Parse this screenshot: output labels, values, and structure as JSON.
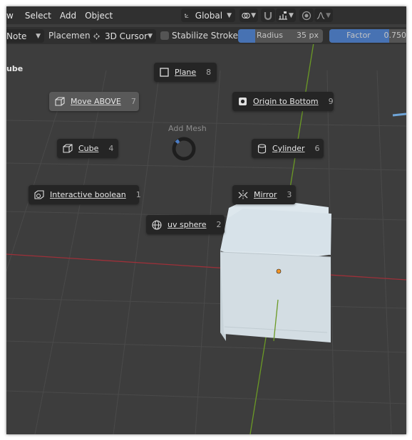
{
  "menubar": {
    "items": [
      "w",
      "Select",
      "Add",
      "Object"
    ],
    "orientation": "Global",
    "snap_icon": "magnet-icon",
    "proportional_icon": "falloff-curve-icon"
  },
  "toolbar": {
    "mode_value": "Note",
    "placement_label": "Placement:",
    "placement_value": "3D Cursor",
    "stabilize_label": "Stabilize Stroke",
    "stabilize_checked": false,
    "radius_label": "Radius",
    "radius_value": "35 px",
    "radius_level": 0.2,
    "factor_label": "Factor",
    "factor_value": "0.750",
    "factor_level": 0.75
  },
  "scene_label": "ube",
  "pie_menu": {
    "title": "Add Mesh",
    "items": [
      {
        "label": "Plane",
        "key": "8",
        "icon": "plane-icon"
      },
      {
        "label": "Move ABOVE",
        "key": "7",
        "icon": "cube-move-icon",
        "active": true
      },
      {
        "label": "Origin to Bottom",
        "key": "9",
        "icon": "origin-icon"
      },
      {
        "label": "Cube",
        "key": "4",
        "icon": "cube-icon"
      },
      {
        "label": "Cylinder",
        "key": "6",
        "icon": "cylinder-icon"
      },
      {
        "label": "Interactive boolean",
        "key": "1",
        "icon": "boolean-icon"
      },
      {
        "label": "Mirror",
        "key": "3",
        "icon": "mirror-icon"
      },
      {
        "label": "uv sphere",
        "key": "2",
        "icon": "sphere-icon"
      }
    ]
  },
  "colors": {
    "viewport_bg": "#3d3d3d",
    "header_bg": "#303030",
    "x_axis": "#a8323c",
    "y_axis": "#6a9a24",
    "slider_fill": "#4772b3",
    "origin_dot": "#f29426"
  }
}
